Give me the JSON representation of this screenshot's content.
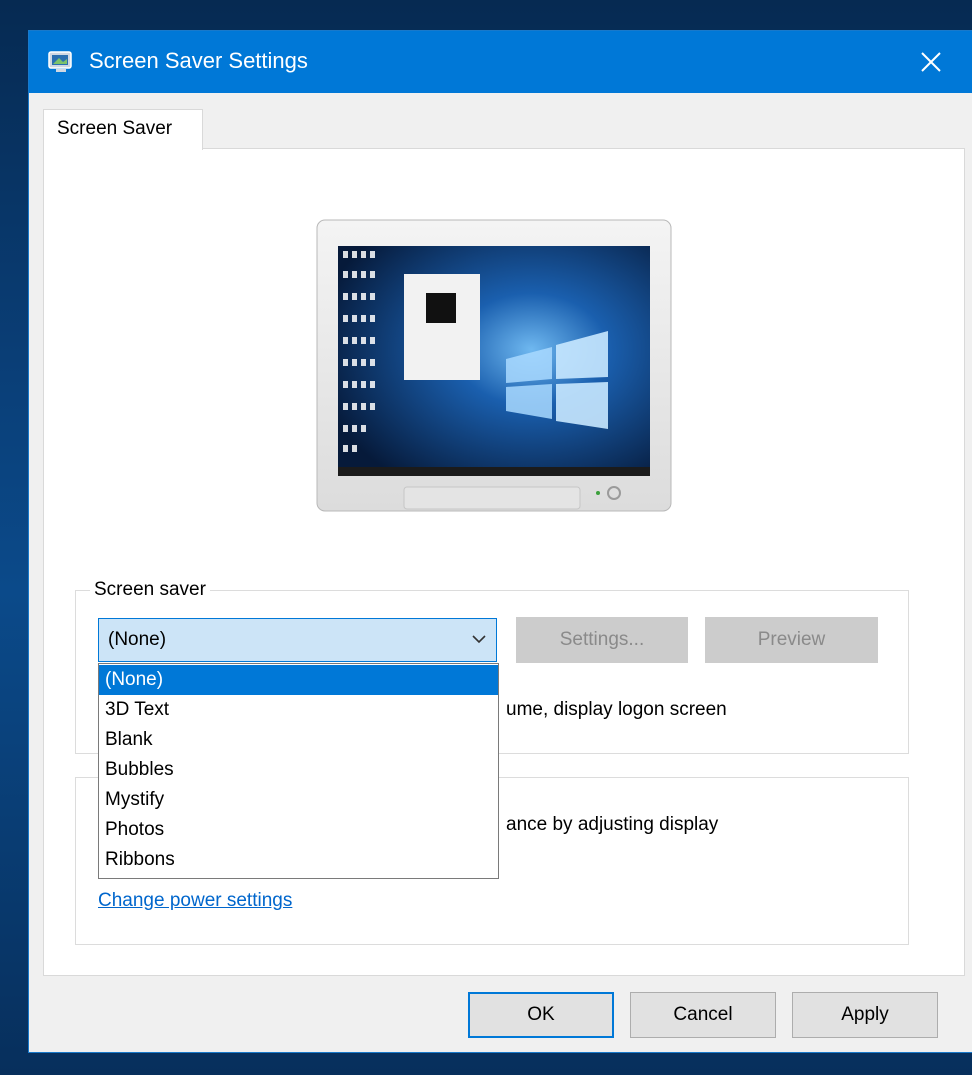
{
  "window": {
    "title": "Screen Saver Settings"
  },
  "tabs": [
    {
      "label": "Screen Saver"
    }
  ],
  "screen_saver_group": {
    "label": "Screen saver",
    "selected_value": "(None)",
    "settings_button": "Settings...",
    "preview_button": "Preview",
    "resume_text_partial": "ume, display logon screen"
  },
  "power_group": {
    "text_partial": "ance by adjusting display",
    "link": "Change power settings"
  },
  "dropdown": {
    "options": [
      "(None)",
      "3D Text",
      "Blank",
      "Bubbles",
      "Mystify",
      "Photos",
      "Ribbons"
    ],
    "selected_index": 0
  },
  "footer": {
    "ok": "OK",
    "cancel": "Cancel",
    "apply": "Apply"
  },
  "colors": {
    "accent": "#0078d7",
    "link": "#0066cc"
  }
}
